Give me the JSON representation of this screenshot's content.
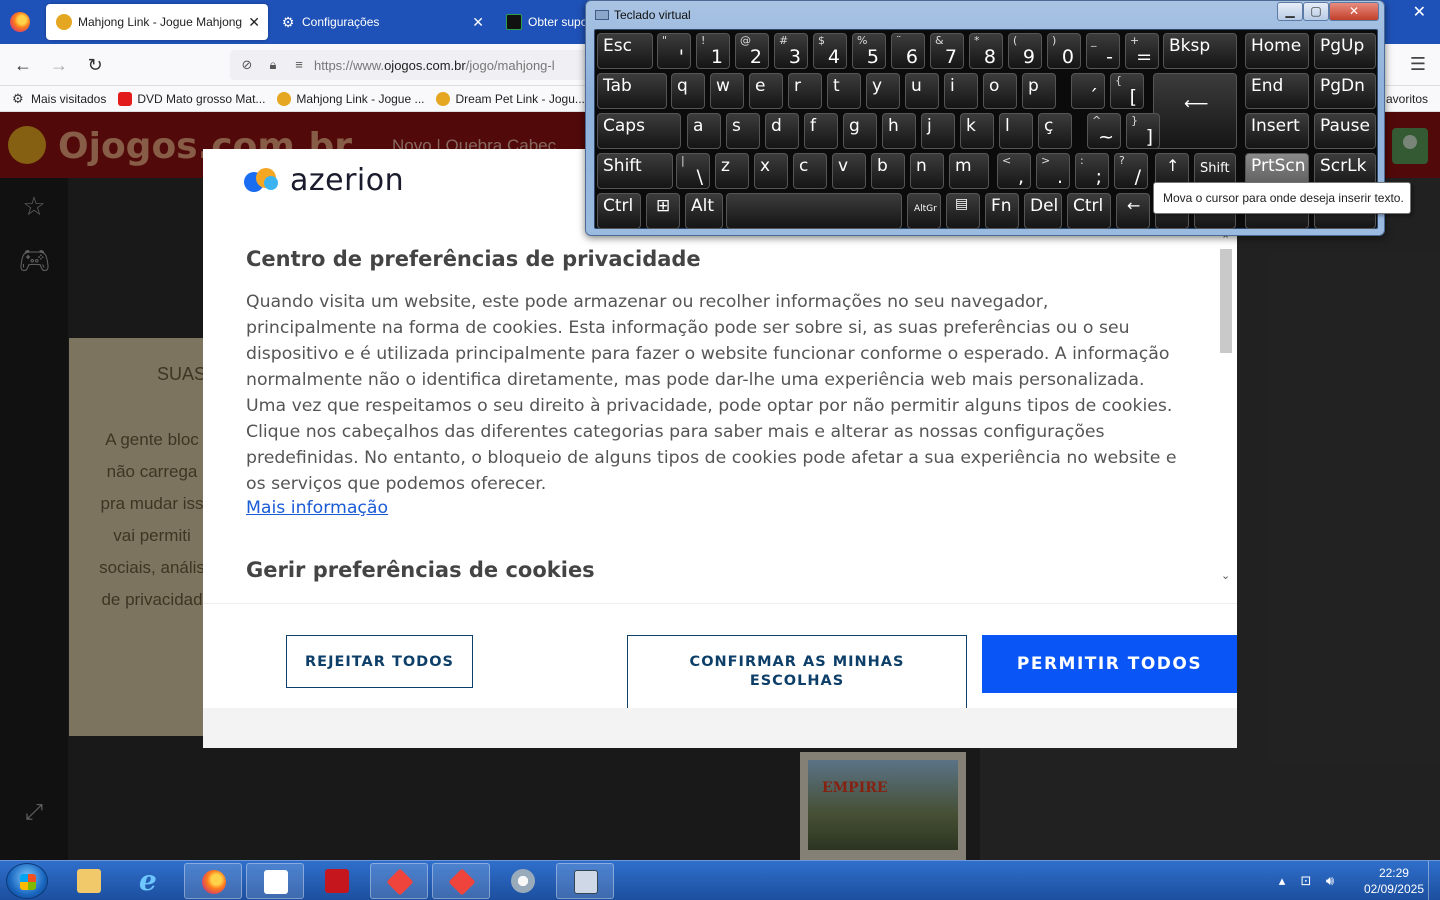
{
  "browser": {
    "tabs": [
      {
        "label": "Mahjong Link - Jogue Mahjong",
        "active": true
      },
      {
        "label": "Configurações",
        "active": false
      },
      {
        "label": "Obter supo",
        "active": false
      }
    ],
    "url_prefix": "https://www.",
    "url_domain": "ojogos.com.br",
    "url_path": "/jogo/mahjong-l",
    "bookmarks": [
      "Mais visitados",
      "DVD Mato grosso Mat...",
      "Mahjong Link - Jogue ...",
      "Dream Pet Link - Jogu..."
    ],
    "bookmarks_other": "avoritos"
  },
  "site": {
    "logo": "Ojogos.com.br",
    "nav": "Novo   |   Quebra Cabeç",
    "side_title": "SUAS",
    "side_text": "A gente bloc\nnão carrega\npra mudar iss\nvai permiti\nsociais, anális\nde privacidad",
    "ad_title": "EMPIRE"
  },
  "modal": {
    "brand": "azerion",
    "title": "Centro de preferências de privacidade",
    "body": "Quando visita um website, este pode armazenar ou recolher informações no seu navegador, principalmente na forma de cookies. Esta informação pode ser sobre si, as suas preferências ou o seu dispositivo e é utilizada principalmente para fazer o website funcionar conforme o esperado. A informação normalmente não o identifica diretamente, mas pode dar-lhe uma experiência web mais personalizada. Uma vez que respeitamos o seu direito à privacidade, pode optar por não permitir alguns tipos de cookies. Clique nos cabeçalhos das diferentes categorias para saber mais e alterar as nossas configurações predefinidas. No entanto, o bloqueio de alguns tipos de cookies pode afetar a sua experiência no website e os serviços que podemos oferecer.",
    "more_link": "Mais informação",
    "section_title": "Gerir preferências de cookies",
    "reject_label": "REJEITAR TODOS",
    "confirm_label": "CONFIRMAR AS MINHAS ESCOLHAS",
    "allow_label": "PERMITIR TODOS"
  },
  "keyboard": {
    "title": "Teclado virtual",
    "tooltip": "Mova o cursor para onde deseja inserir texto.",
    "highlighted_key": "PrtScn"
  },
  "taskbar": {
    "time": "22:29",
    "date": "02/09/2025"
  },
  "colors": {
    "modal_primary": "#0a55f5",
    "modal_outline": "#0d3f69",
    "site_header": "#8e1111"
  }
}
